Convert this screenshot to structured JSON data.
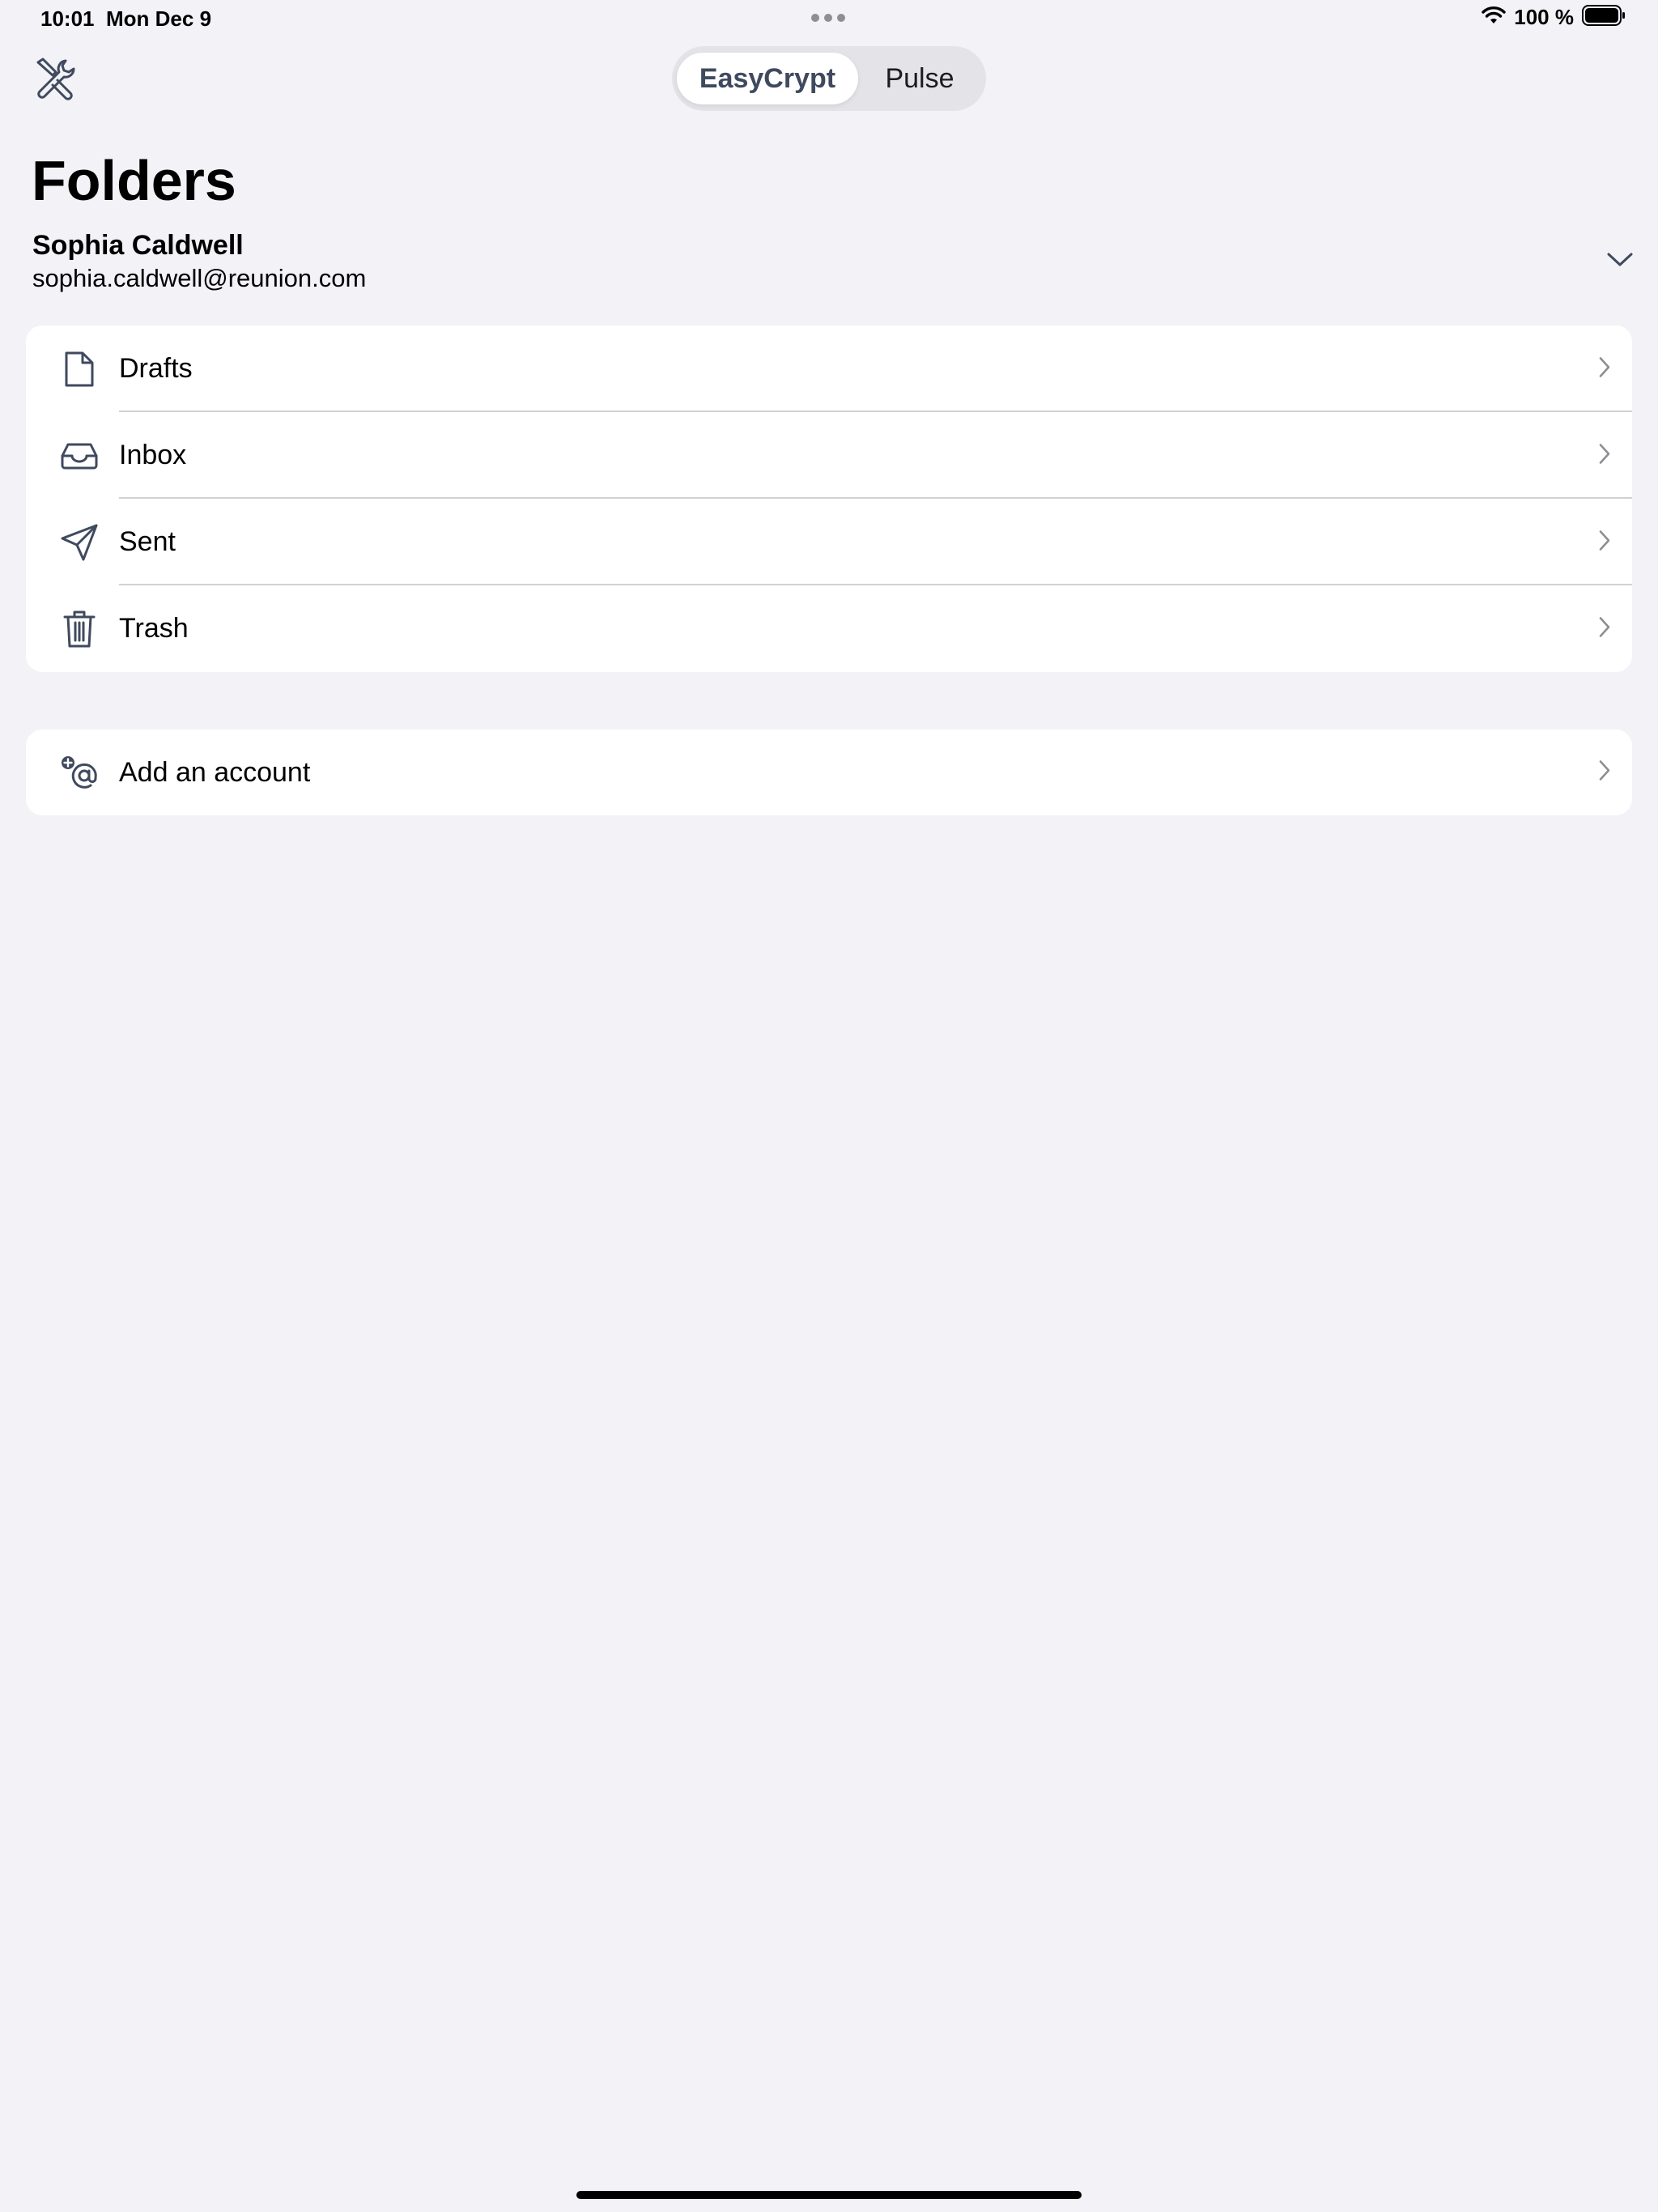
{
  "status_bar": {
    "time": "10:01",
    "date": "Mon Dec 9",
    "battery": "100 %"
  },
  "toolbar": {
    "tools_icon": "tools-icon",
    "segments": [
      {
        "label": "EasyCrypt",
        "selected": true
      },
      {
        "label": "Pulse",
        "selected": false
      }
    ]
  },
  "page": {
    "title": "Folders"
  },
  "account": {
    "name": "Sophia Caldwell",
    "email": "sophia.caldwell@reunion.com"
  },
  "folders": [
    {
      "label": "Drafts",
      "icon": "document-icon"
    },
    {
      "label": "Inbox",
      "icon": "inbox-tray-icon"
    },
    {
      "label": "Sent",
      "icon": "paper-plane-icon"
    },
    {
      "label": "Trash",
      "icon": "trash-icon"
    }
  ],
  "actions": {
    "add_account": {
      "label": "Add an account",
      "icon": "add-at-icon"
    }
  },
  "colors": {
    "background": "#f2f2f7",
    "card": "#ffffff",
    "icon": "#3f4a5e",
    "chevron": "#8e8e93",
    "divider": "#d1d1d6"
  }
}
